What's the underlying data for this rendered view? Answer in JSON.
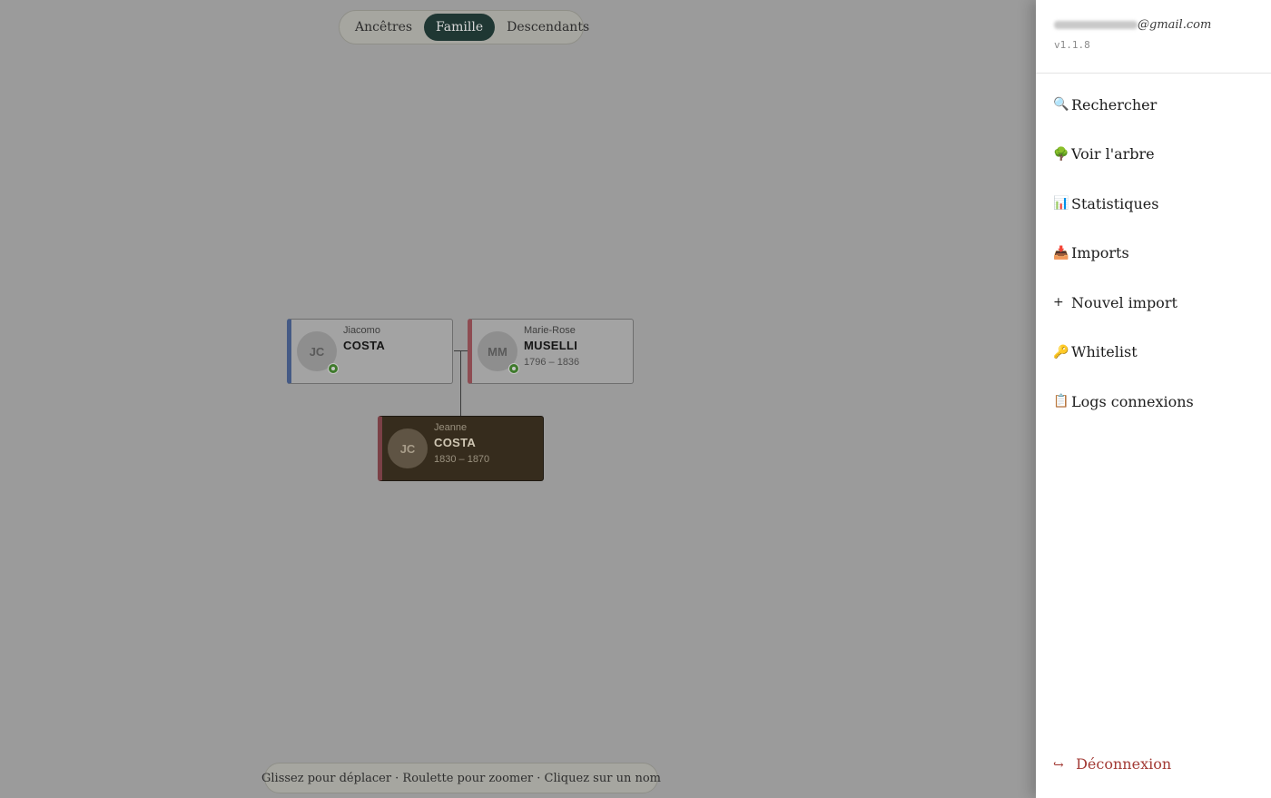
{
  "view_tabs": [
    "Ancêtres",
    "Famille",
    "Descendants"
  ],
  "active_tab": "Famille",
  "people": {
    "father": {
      "initials": "JC",
      "first": "Jiacomo",
      "last": "COSTA",
      "dates": ""
    },
    "mother": {
      "initials": "MM",
      "first": "Marie-Rose",
      "last": "MUSELLI",
      "dates": "1796 – 1836"
    },
    "child": {
      "initials": "JC",
      "first": "Jeanne",
      "last": "COSTA",
      "dates": "1830 – 1870"
    }
  },
  "hint": "Glissez pour déplacer · Roulette pour zoomer · Cliquez sur un nom",
  "drawer": {
    "email_suffix": "@gmail.com",
    "version": "v1.1.8",
    "menu": [
      {
        "icon": "🔍",
        "label": "Rechercher",
        "icon_name": "search-icon"
      },
      {
        "icon": "🌳",
        "label": "Voir l'arbre",
        "icon_name": "tree-icon"
      },
      {
        "icon": "📊",
        "label": "Statistiques",
        "icon_name": "chart-icon"
      },
      {
        "icon": "📥",
        "label": "Imports",
        "icon_name": "inbox-icon"
      },
      {
        "icon": "+",
        "label": "Nouvel import",
        "icon_name": "plus-icon"
      },
      {
        "icon": "🔑",
        "label": "Whitelist",
        "icon_name": "key-icon"
      },
      {
        "icon": "📋",
        "label": "Logs connexions",
        "icon_name": "clipboard-icon"
      }
    ],
    "logout": {
      "icon": "↪",
      "label": "Déconnexion"
    }
  },
  "colors": {
    "active_tab": "#1f3733",
    "male_accent": "#455a85",
    "female_accent": "#8e4c52",
    "logout": "#a33b36"
  }
}
